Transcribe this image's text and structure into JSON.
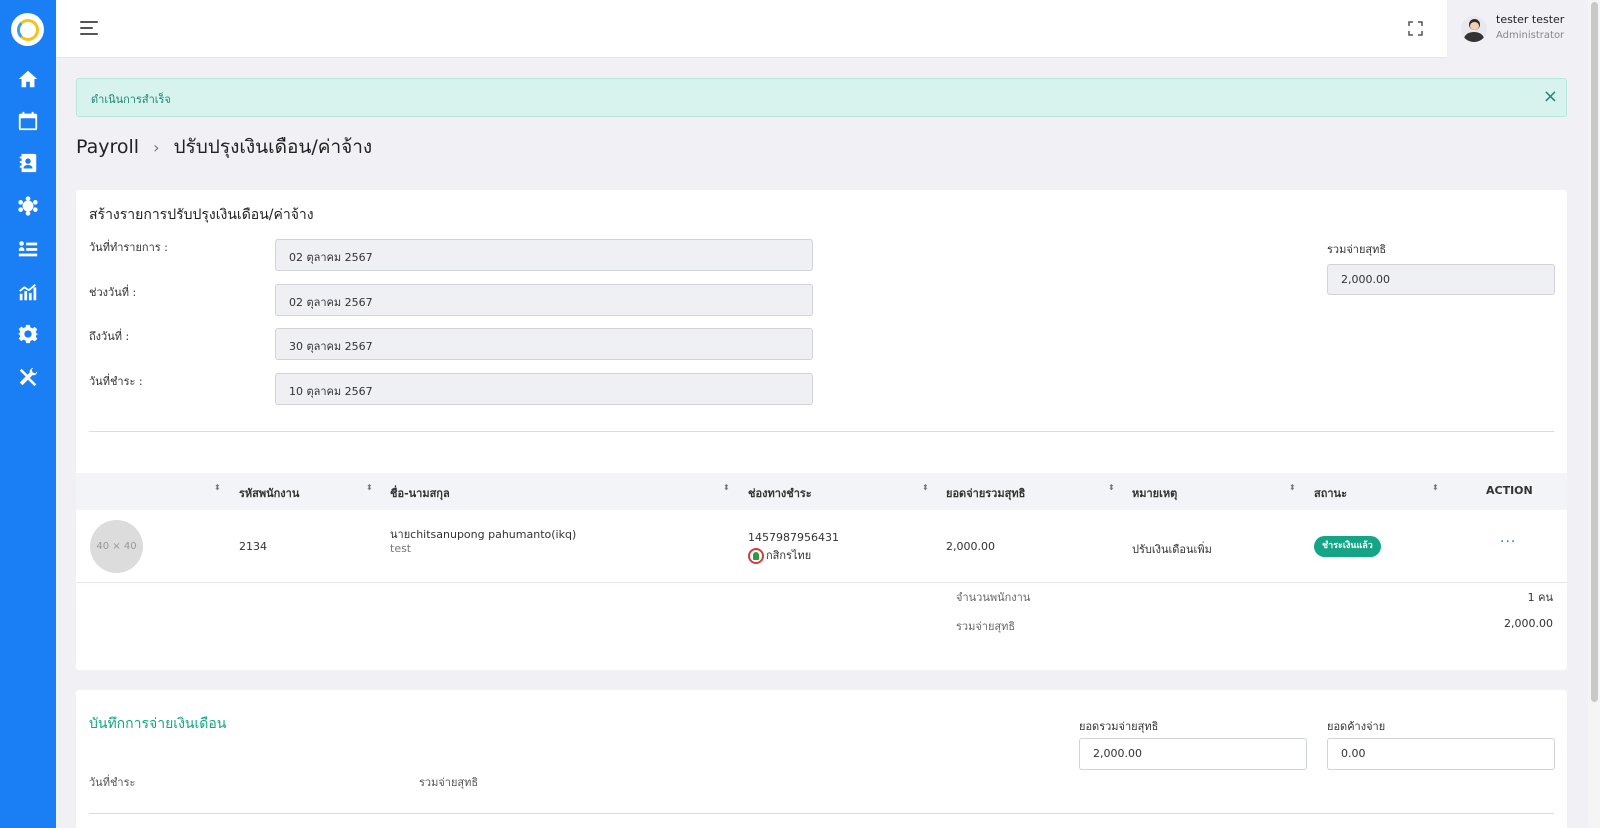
{
  "topbar": {
    "user_name": "tester tester",
    "user_role": "Administrator"
  },
  "alert": {
    "message": "ดำเนินการสำเร็จ",
    "close": "×"
  },
  "breadcrumb": {
    "root": "Payroll",
    "separator": "›",
    "current": "ปรับปรุงเงินเดือน/ค่าจ้าง"
  },
  "form": {
    "title": "สร้างรายการปรับปรุงเงินเดือน/ค่าจ้าง",
    "fields": [
      {
        "label": "วันที่ทำรายการ :",
        "value": "02 ตุลาคม 2567"
      },
      {
        "label": "ช่วงวันที่ :",
        "value": "02 ตุลาคม 2567"
      },
      {
        "label": "ถึงวันที่ :",
        "value": "30 ตุลาคม 2567"
      },
      {
        "label": "วันที่ชำระ :",
        "value": "10 ตุลาคม 2567"
      }
    ],
    "net_label": "รวมจ่ายสุทธิ",
    "net_value": "2,000.00"
  },
  "table": {
    "headers": [
      "รหัสพนักงาน",
      "ชื่อ-นามสกุล",
      "ช่องทางชำระ",
      "ยอดจ่ายรวมสุทธิ",
      "หมายเหตุ",
      "สถานะ",
      "ACTION"
    ],
    "sort_glyph": "⬍",
    "rows": [
      {
        "photo": "40 × 40",
        "employee_id": "2134",
        "name": "นายchitsanupong pahumanto(ikq)",
        "name_sub": "test",
        "account": "1457987956431",
        "bank": "กสิกรไทย",
        "net": "2,000.00",
        "note": "ปรับเงินเดือนเพิ่ม",
        "status": "ชำระเงินแล้ว",
        "action": "···"
      }
    ]
  },
  "summary": {
    "count_label": "จำนวนพนักงาน",
    "count_value": "1 คน",
    "net_label": "รวมจ่ายสุทธิ",
    "net_value": "2,000.00"
  },
  "payment_record": {
    "title": "บันทึกการจ่ายเงินเดือน",
    "total_label": "ยอดรวมจ่ายสุทธิ",
    "total_value": "2,000.00",
    "outstanding_label": "ยอดค้างจ่าย",
    "outstanding_value": "0.00",
    "col_pay_date": "วันที่ชำระ",
    "col_net": "รวมจ่ายสุทธิ"
  },
  "colors": {
    "sidebar": "#1a7ff5",
    "accent_teal": "#13a585",
    "alert_bg": "#d8f3ee"
  },
  "icons": [
    "home-icon",
    "calendar-dollar-icon",
    "address-book-icon",
    "users-gear-icon",
    "list-icon",
    "chart-icon",
    "gear-icon",
    "tools-icon"
  ]
}
